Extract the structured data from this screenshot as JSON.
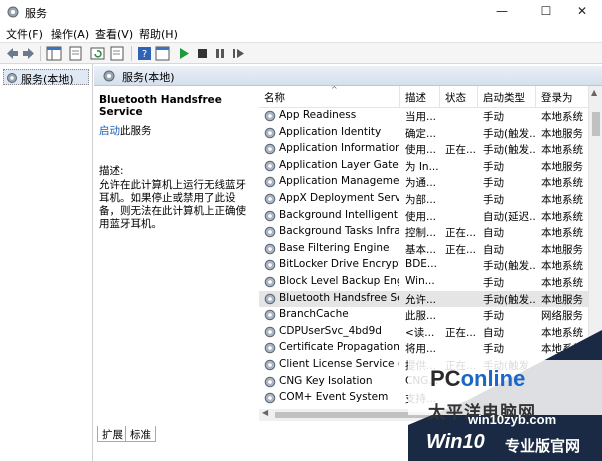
{
  "window": {
    "title": "服务",
    "minimize": "—",
    "maximize": "☐",
    "close": "✕"
  },
  "menu": [
    "文件(F)",
    "操作(A)",
    "查看(V)",
    "帮助(H)"
  ],
  "tree": {
    "item": "服务(本地)"
  },
  "pane_header": "服务(本地)",
  "details": {
    "title": "Bluetooth Handsfree Service",
    "start_link": "启动",
    "start_suffix": "此服务",
    "desc_label": "描述:",
    "desc_text": "允许在此计算机上运行无线蓝牙耳机。如果停止或禁用了此设备，则无法在此计算机上正确使用蓝牙耳机。"
  },
  "columns": [
    "名称",
    "描述",
    "状态",
    "启动类型",
    "登录为"
  ],
  "rows": [
    {
      "name": "App Readiness",
      "desc": "当用...",
      "status": "",
      "startup": "手动",
      "logon": "本地系统"
    },
    {
      "name": "Application Identity",
      "desc": "确定...",
      "status": "",
      "startup": "手动(触发...",
      "logon": "本地服务"
    },
    {
      "name": "Application Information",
      "desc": "使用...",
      "status": "正在...",
      "startup": "手动(触发...",
      "logon": "本地系统"
    },
    {
      "name": "Application Layer Gatewa...",
      "desc": "为 In...",
      "status": "",
      "startup": "手动",
      "logon": "本地服务"
    },
    {
      "name": "Application Management",
      "desc": "为通...",
      "status": "",
      "startup": "手动",
      "logon": "本地系统"
    },
    {
      "name": "AppX Deployment Servic...",
      "desc": "为部...",
      "status": "",
      "startup": "手动",
      "logon": "本地系统"
    },
    {
      "name": "Background Intelligent T...",
      "desc": "使用...",
      "status": "",
      "startup": "自动(延迟...",
      "logon": "本地系统"
    },
    {
      "name": "Background Tasks Infras...",
      "desc": "控制...",
      "status": "正在...",
      "startup": "自动",
      "logon": "本地系统"
    },
    {
      "name": "Base Filtering Engine",
      "desc": "基本...",
      "status": "正在...",
      "startup": "自动",
      "logon": "本地服务"
    },
    {
      "name": "BitLocker Drive Encryptio...",
      "desc": "BDE...",
      "status": "",
      "startup": "手动(触发...",
      "logon": "本地系统"
    },
    {
      "name": "Block Level Backup Engi...",
      "desc": "Win...",
      "status": "",
      "startup": "手动",
      "logon": "本地系统"
    },
    {
      "name": "Bluetooth Handsfree Ser...",
      "desc": "允许...",
      "status": "",
      "startup": "手动(触发...",
      "logon": "本地服务",
      "selected": true
    },
    {
      "name": "BranchCache",
      "desc": "此服...",
      "status": "",
      "startup": "手动",
      "logon": "网络服务"
    },
    {
      "name": "CDPUserSvc_4bd9d",
      "desc": "<读...",
      "status": "正在...",
      "startup": "自动",
      "logon": "本地系统"
    },
    {
      "name": "Certificate Propagation",
      "desc": "将用...",
      "status": "",
      "startup": "手动",
      "logon": "本地系统"
    },
    {
      "name": "Client License Service (Cli...",
      "desc": "提供...",
      "status": "正在...",
      "startup": "手动(触发...",
      "logon": "本地系统"
    },
    {
      "name": "CNG Key Isolation",
      "desc": "CNG...",
      "status": "",
      "startup": "",
      "logon": ""
    },
    {
      "name": "COM+ Event System",
      "desc": "支持...",
      "status": "",
      "startup": "",
      "logon": ""
    }
  ],
  "tabs": [
    "扩展",
    "标准"
  ],
  "watermark": {
    "logo_p": "PC",
    "logo_rest": "online",
    "cn": "太平洋电脑网",
    "site": "win10zyb.com",
    "brand": "Win10",
    "brand_cn": "专业版官网"
  },
  "colors": {
    "selected_row": "#e5e5e5",
    "link": "#1a5fb4",
    "watermark_dark": "#1b2a44",
    "watermark_accent": "#1b66c9"
  }
}
